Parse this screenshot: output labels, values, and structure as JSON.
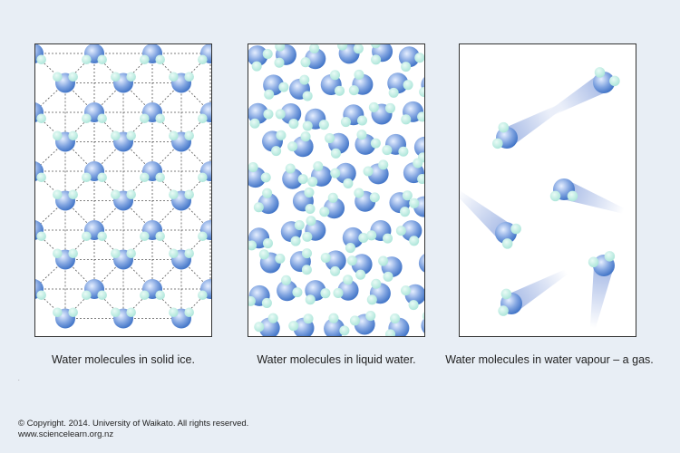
{
  "panels": [
    {
      "id": "ice",
      "caption": "Water molecules in solid ice."
    },
    {
      "id": "liquid",
      "caption": "Water molecules in liquid water."
    },
    {
      "id": "vapour",
      "caption": "Water molecules in water vapour – a gas."
    }
  ],
  "footer": {
    "copyright": "© Copyright. 2014. University of Waikato. All rights reserved.",
    "website": "www.sciencelearn.org.nz"
  },
  "colors": {
    "oxygen": "#3a6fc4",
    "oxygen_highlight": "#e6efff",
    "hydrogen": "#a9e4d8",
    "hydrogen_highlight": "#e9fbf6",
    "hydrogen_bond": "#555555",
    "background": "#e8eef5"
  }
}
